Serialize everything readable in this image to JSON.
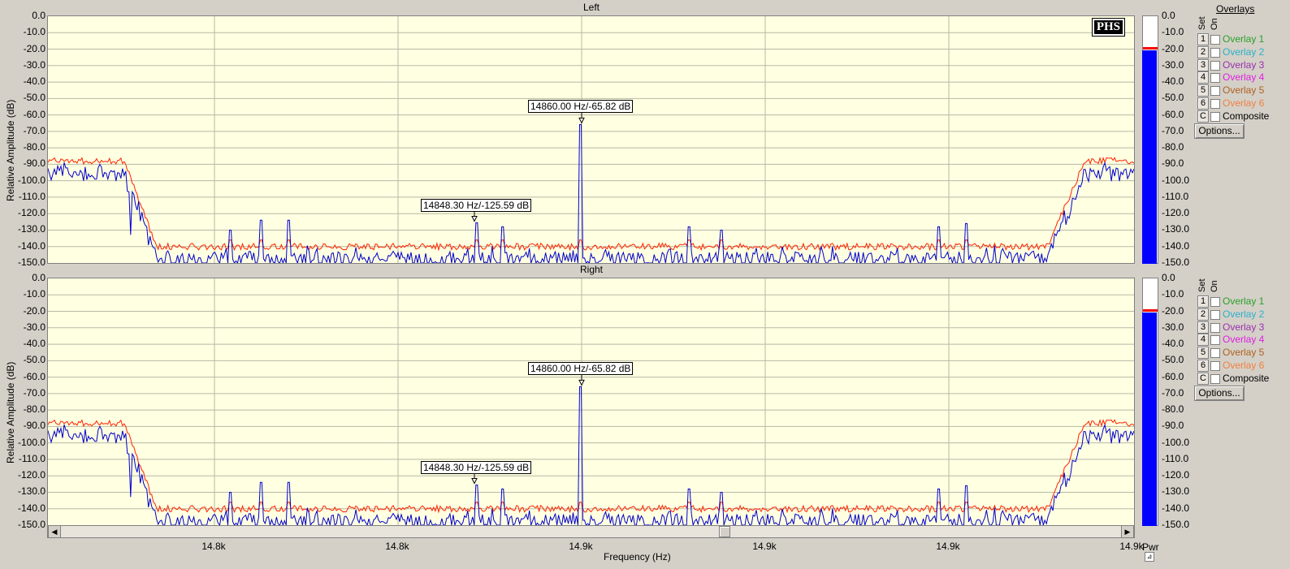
{
  "colors": {
    "plot_bg": "#ffffe1",
    "trace_blue": "#0000cc",
    "trace_red": "#ff2200",
    "meter": "#0000ff",
    "overlay1": "#2aa02a",
    "overlay2": "#2ab0c8",
    "overlay3": "#9b2fae",
    "overlay4": "#e020e0",
    "overlay5": "#b06020",
    "overlay6": "#f08040",
    "composite": "#000000"
  },
  "panels": [
    {
      "title": "Left",
      "ylabel": "Relative Amplitude (dB)",
      "yticks": [
        "0.0",
        "-10.0",
        "-20.0",
        "-30.0",
        "-40.0",
        "-50.0",
        "-60.0",
        "-70.0",
        "-80.0",
        "-90.0",
        "-100.0",
        "-110.0",
        "-120.0",
        "-130.0",
        "-140.0",
        "-150.0"
      ],
      "meter_ticks": [
        "0.0",
        "-10.0",
        "-20.0",
        "-30.0",
        "-40.0",
        "-50.0",
        "-60.0",
        "-70.0",
        "-80.0",
        "-90.0",
        "-100.0",
        "-110.0",
        "-120.0",
        "-130.0",
        "-140.0",
        "-150.0"
      ],
      "annotations": [
        {
          "text": "14860.00 Hz/-65.82 dB",
          "freq": 14860.0,
          "db": -65.82
        },
        {
          "text": "14848.30 Hz/-125.59 dB",
          "freq": 14848.3,
          "db": -125.59
        }
      ],
      "logo": "PHS",
      "meter_level_db": -20.0
    },
    {
      "title": "Right",
      "ylabel": "Relative Amplitude (dB)",
      "yticks": [
        "0.0",
        "-10.0",
        "-20.0",
        "-30.0",
        "-40.0",
        "-50.0",
        "-60.0",
        "-70.0",
        "-80.0",
        "-90.0",
        "-100.0",
        "-110.0",
        "-120.0",
        "-130.0",
        "-140.0",
        "-150.0"
      ],
      "meter_ticks": [
        "0.0",
        "-10.0",
        "-20.0",
        "-30.0",
        "-40.0",
        "-50.0",
        "-60.0",
        "-70.0",
        "-80.0",
        "-90.0",
        "-100.0",
        "-110.0",
        "-120.0",
        "-130.0",
        "-140.0",
        "-150.0"
      ],
      "annotations": [
        {
          "text": "14860.00 Hz/-65.82 dB",
          "freq": 14860.0,
          "db": -65.82
        },
        {
          "text": "14848.30 Hz/-125.59 dB",
          "freq": 14848.3,
          "db": -125.59
        }
      ],
      "meter_level_db": -20.0
    }
  ],
  "overlays": {
    "title": "Overlays",
    "set_label": "Set",
    "on_label": "On",
    "items": [
      {
        "num": "1",
        "label": "Overlay 1",
        "color": "#2aa02a"
      },
      {
        "num": "2",
        "label": "Overlay 2",
        "color": "#2ab0c8"
      },
      {
        "num": "3",
        "label": "Overlay 3",
        "color": "#9b2fae"
      },
      {
        "num": "4",
        "label": "Overlay 4",
        "color": "#e020e0"
      },
      {
        "num": "5",
        "label": "Overlay 5",
        "color": "#b06020"
      },
      {
        "num": "6",
        "label": "Overlay 6",
        "color": "#f08040"
      },
      {
        "num": "C",
        "label": "Composite",
        "color": "#000000"
      }
    ],
    "options_label": "Options..."
  },
  "xaxis": {
    "label": "Frequency (Hz)",
    "ticks": [
      "14.8k",
      "14.8k",
      "14.9k",
      "14.9k",
      "14.9k",
      "14.9k"
    ],
    "range_hz": [
      14815.4,
      14874.6
    ]
  },
  "pwr_label": "Pwr",
  "chart_data": [
    {
      "type": "line",
      "title": "Left",
      "xlabel": "Frequency (Hz)",
      "ylabel": "Relative Amplitude (dB)",
      "ylim": [
        -150,
        0
      ],
      "series": [
        {
          "values": []
        },
        {
          "values": []
        }
      ],
      "markers": [
        {
          "x": 14860.0,
          "y": -65.82
        },
        {
          "x": 14848.3,
          "y": -125.59
        }
      ]
    },
    {
      "type": "line",
      "title": "Right",
      "xlabel": "Frequency (Hz)",
      "ylabel": "Relative Amplitude (dB)",
      "ylim": [
        -150,
        0
      ],
      "series": [
        {
          "values": []
        },
        {
          "values": []
        }
      ],
      "markers": [
        {
          "x": 14860.0,
          "y": -65.82
        },
        {
          "x": 14848.3,
          "y": -125.59
        }
      ]
    }
  ]
}
